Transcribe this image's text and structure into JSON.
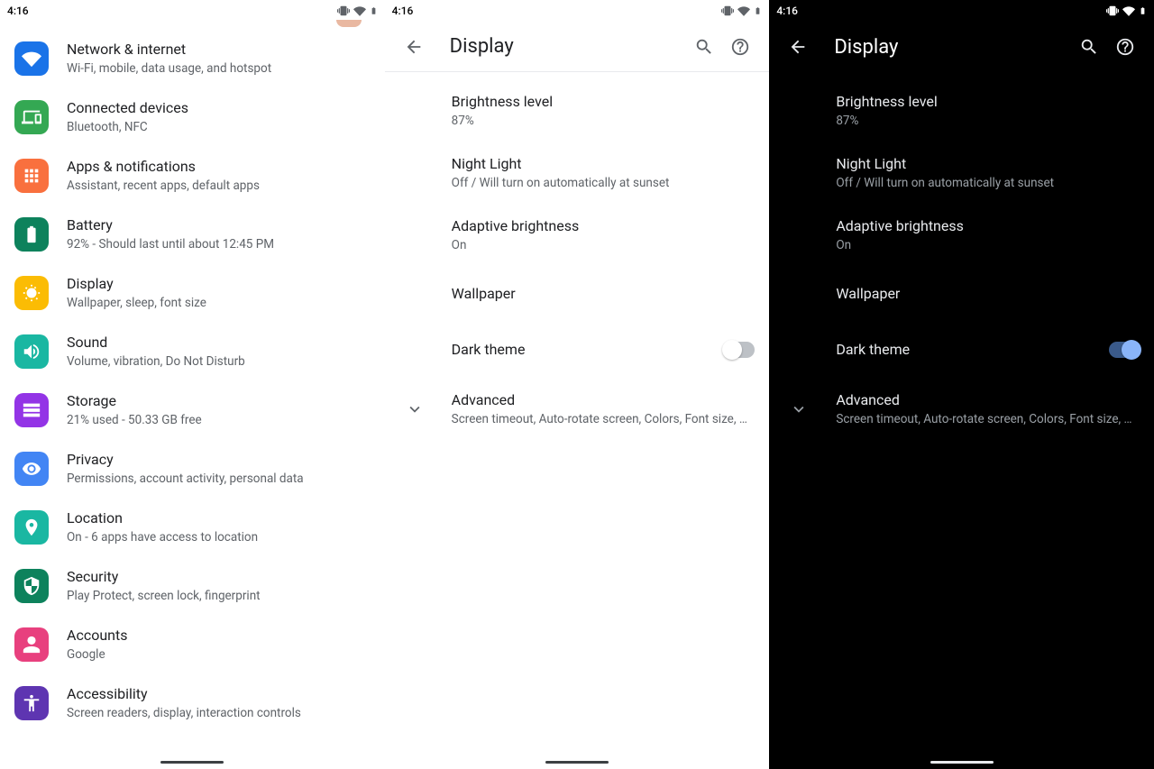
{
  "status": {
    "time": "4:16"
  },
  "settings": {
    "items": [
      {
        "title": "Network & internet",
        "sub": "Wi-Fi, mobile, data usage, and hotspot",
        "icon": "wifi",
        "color": "#1a73e8"
      },
      {
        "title": "Connected devices",
        "sub": "Bluetooth, NFC",
        "icon": "devices",
        "color": "#34a853"
      },
      {
        "title": "Apps & notifications",
        "sub": "Assistant, recent apps, default apps",
        "icon": "apps",
        "color": "#f9703e"
      },
      {
        "title": "Battery",
        "sub": "92% - Should last until about 12:45 PM",
        "icon": "battery",
        "color": "#0d825c"
      },
      {
        "title": "Display",
        "sub": "Wallpaper, sleep, font size",
        "icon": "brightness",
        "color": "#fbbc04"
      },
      {
        "title": "Sound",
        "sub": "Volume, vibration, Do Not Disturb",
        "icon": "sound",
        "color": "#1ab7a2"
      },
      {
        "title": "Storage",
        "sub": "21% used - 50.33 GB free",
        "icon": "storage",
        "color": "#9334e6"
      },
      {
        "title": "Privacy",
        "sub": "Permissions, account activity, personal data",
        "icon": "privacy",
        "color": "#4285f4"
      },
      {
        "title": "Location",
        "sub": "On - 6 apps have access to location",
        "icon": "location",
        "color": "#1ab7a2"
      },
      {
        "title": "Security",
        "sub": "Play Protect, screen lock, fingerprint",
        "icon": "security",
        "color": "#0d825c"
      },
      {
        "title": "Accounts",
        "sub": "Google",
        "icon": "accounts",
        "color": "#e8407e"
      },
      {
        "title": "Accessibility",
        "sub": "Screen readers, display, interaction controls",
        "icon": "accessibility",
        "color": "#5e35b1"
      }
    ]
  },
  "display": {
    "title": "Display",
    "items": {
      "brightness": {
        "title": "Brightness level",
        "sub": "87%"
      },
      "nightlight": {
        "title": "Night Light",
        "sub": "Off / Will turn on automatically at sunset"
      },
      "adaptive": {
        "title": "Adaptive brightness",
        "sub": "On"
      },
      "wallpaper": {
        "title": "Wallpaper"
      },
      "darktheme": {
        "title": "Dark theme"
      },
      "advanced": {
        "title": "Advanced",
        "sub": "Screen timeout, Auto-rotate screen, Colors, Font size, Displa.."
      }
    }
  }
}
